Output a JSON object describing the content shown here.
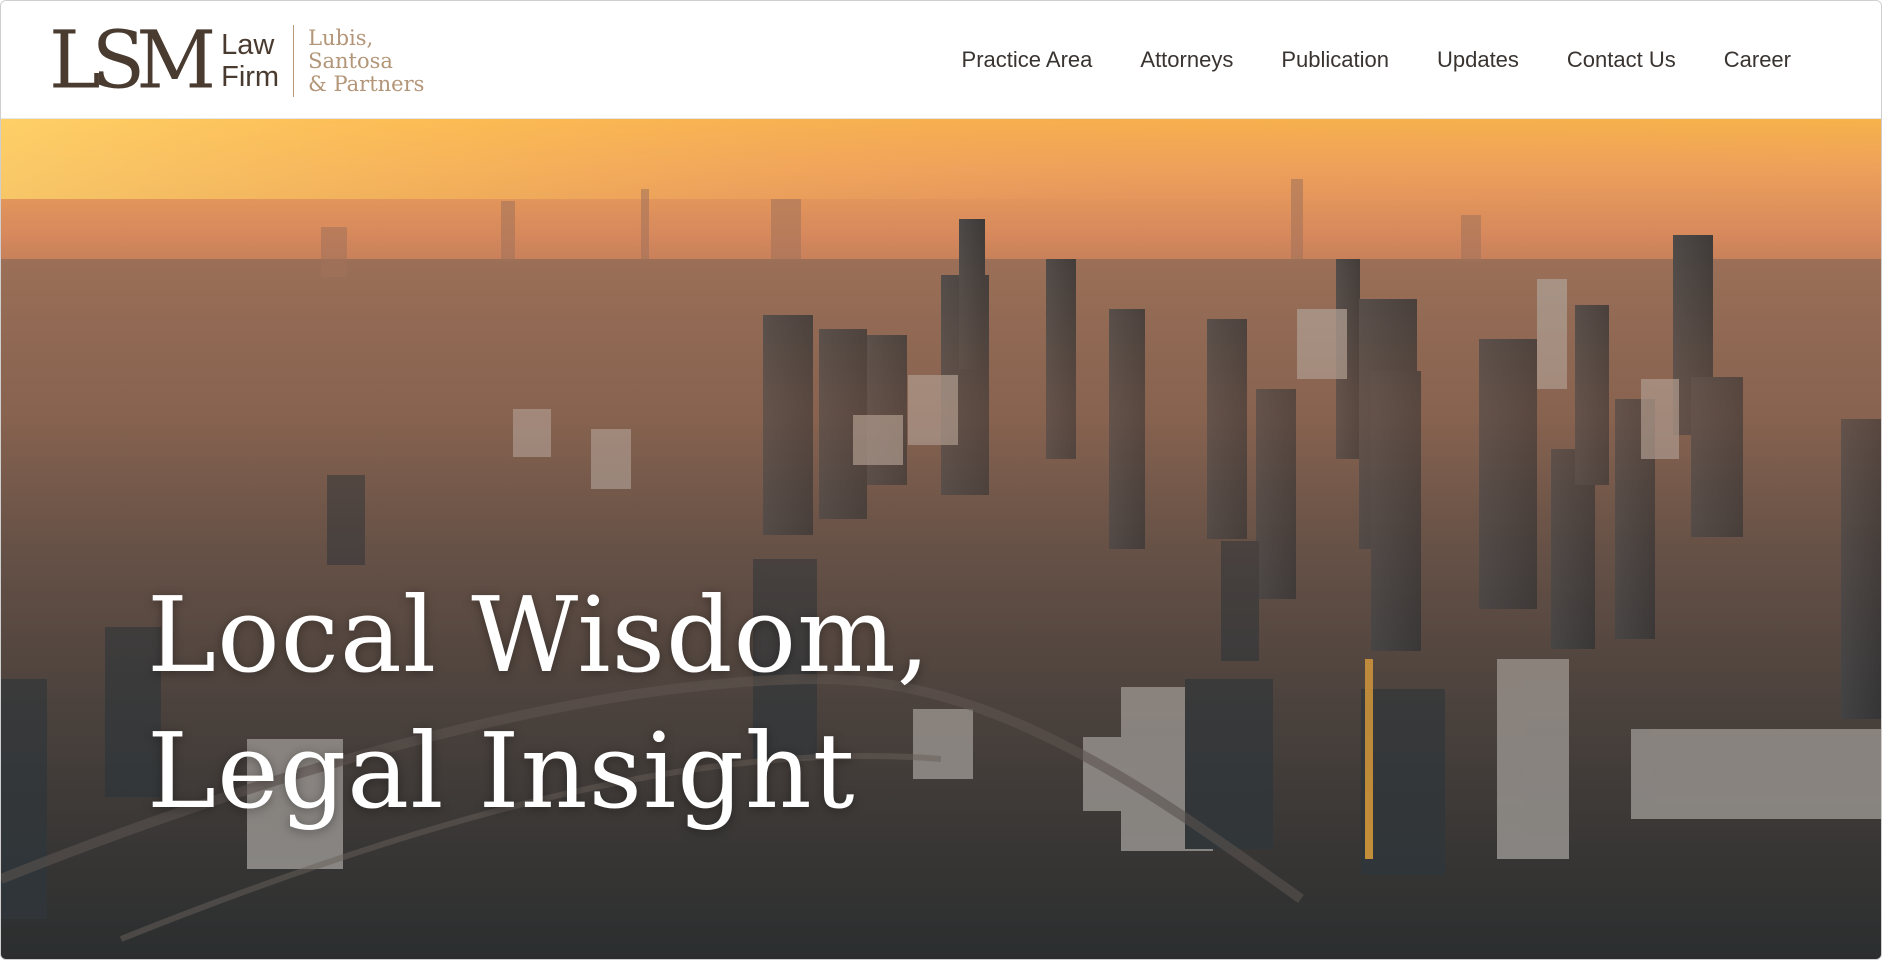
{
  "logo": {
    "mark": "LSM",
    "line1": "Law",
    "line2": "Firm",
    "partners1": "Lubis,",
    "partners2": "Santosa",
    "partners3": "& Partners"
  },
  "nav": {
    "items": [
      {
        "label": "Practice Area"
      },
      {
        "label": "Attorneys"
      },
      {
        "label": "Publication"
      },
      {
        "label": "Updates"
      },
      {
        "label": "Contact Us"
      },
      {
        "label": "Career"
      }
    ]
  },
  "hero": {
    "line1": "Local Wisdom,",
    "line2": "Legal Insight"
  },
  "colors": {
    "brand_brown": "#4a3b30",
    "brand_tan": "#b39578",
    "nav_text": "#3a3431",
    "sky_top": "#f7b24a"
  }
}
